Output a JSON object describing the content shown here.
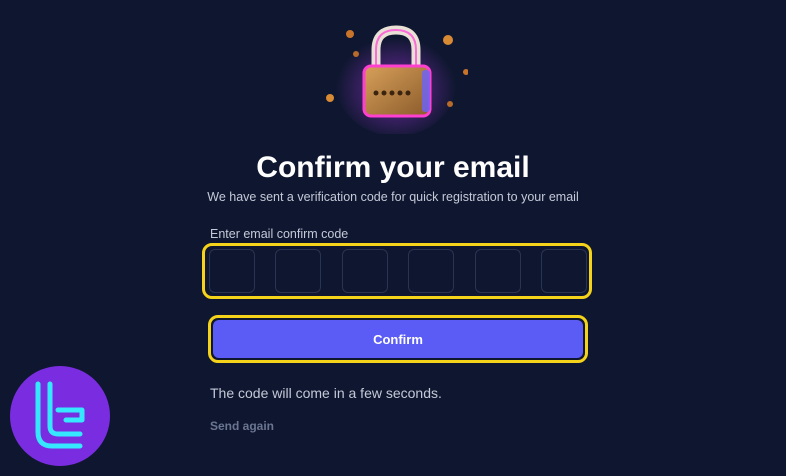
{
  "header": {
    "illustration_icon": "padlock-icon"
  },
  "title": "Confirm your email",
  "subtitle": "We have sent a verification code for quick registration to your email",
  "code_field": {
    "label": "Enter email confirm code",
    "digits": [
      "",
      "",
      "",
      "",
      "",
      ""
    ]
  },
  "confirm_button": {
    "label": "Confirm"
  },
  "info_text": "The code will come in a few seconds.",
  "send_again_label": "Send again",
  "colors": {
    "background": "#0f1730",
    "accent": "#5b5cf5",
    "highlight": "#f5d31a",
    "muted_text": "#6b7590"
  },
  "watermark": {
    "icon": "logo-watermark-icon"
  }
}
